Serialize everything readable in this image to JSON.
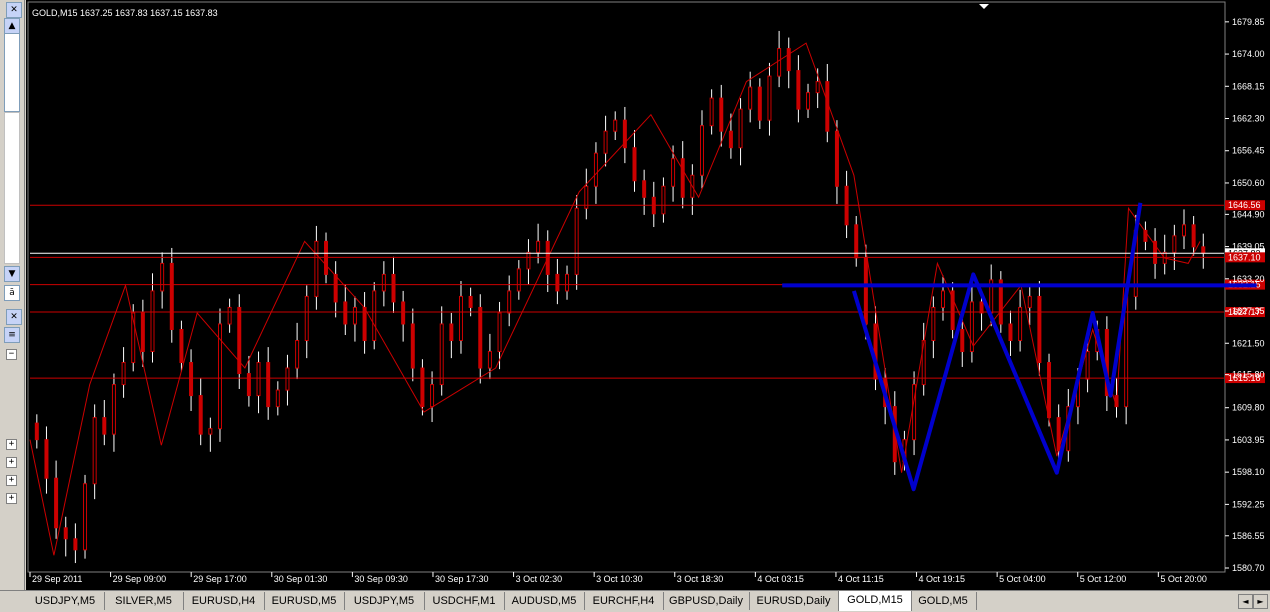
{
  "chart_header": "GOLD,M15  1637.25 1637.83 1637.15 1637.83",
  "chart_data": {
    "type": "candlestick",
    "symbol": "GOLD",
    "timeframe": "M15",
    "ohlc_last": {
      "open": 1637.25,
      "high": 1637.83,
      "low": 1637.15,
      "close": 1637.83
    },
    "ylim": [
      1580.7,
      1682.0
    ],
    "y_ticks": [
      "1679.85",
      "1674.00",
      "1668.15",
      "1662.30",
      "1656.45",
      "1650.60",
      "1644.90",
      "1639.05",
      "1633.20",
      "1627.35",
      "1621.50",
      "1615.80",
      "1609.80",
      "1603.95",
      "1598.10",
      "1592.25",
      "1586.55",
      "1580.70"
    ],
    "x_ticks": [
      "29 Sep 2011",
      "29 Sep 09:00",
      "29 Sep 17:00",
      "30 Sep 01:30",
      "30 Sep 09:30",
      "30 Sep 17:30",
      "3 Oct 02:30",
      "3 Oct 10:30",
      "3 Oct 18:30",
      "4 Oct 03:15",
      "4 Oct 11:15",
      "4 Oct 19:15",
      "5 Oct 04:00",
      "5 Oct 12:00",
      "5 Oct 20:00"
    ],
    "price_lines": [
      {
        "label": "1646.56",
        "value": 1646.56,
        "color": "#cc0000"
      },
      {
        "label": "1637.83",
        "value": 1637.83,
        "color": "#ffffff",
        "current": true
      },
      {
        "label": "1637.10",
        "value": 1637.1,
        "color": "#cc0000"
      },
      {
        "label": "1632.15",
        "value": 1632.15,
        "color": "#cc0000"
      },
      {
        "label": "1627.17",
        "value": 1627.17,
        "color": "#cc0000"
      },
      {
        "label": "1615.18",
        "value": 1615.18,
        "color": "#cc0000"
      }
    ],
    "zigzag_path": [
      [
        0,
        1604
      ],
      [
        0.02,
        1583
      ],
      [
        0.05,
        1614
      ],
      [
        0.08,
        1632
      ],
      [
        0.11,
        1603
      ],
      [
        0.14,
        1627
      ],
      [
        0.18,
        1617
      ],
      [
        0.23,
        1640
      ],
      [
        0.28,
        1628
      ],
      [
        0.33,
        1609
      ],
      [
        0.39,
        1617
      ],
      [
        0.46,
        1649
      ],
      [
        0.52,
        1663
      ],
      [
        0.56,
        1648
      ],
      [
        0.6,
        1669
      ],
      [
        0.65,
        1676
      ],
      [
        0.69,
        1652
      ],
      [
        0.73,
        1598
      ],
      [
        0.76,
        1636
      ],
      [
        0.79,
        1621
      ],
      [
        0.83,
        1632
      ],
      [
        0.86,
        1601
      ],
      [
        0.89,
        1624
      ],
      [
        0.91,
        1610
      ],
      [
        0.92,
        1646
      ],
      [
        0.95,
        1637
      ],
      [
        0.97,
        1636
      ],
      [
        0.98,
        1640
      ]
    ],
    "candles_close": [
      1604,
      1597,
      1588,
      1586,
      1584,
      1596,
      1608,
      1605,
      1614,
      1618,
      1627,
      1620,
      1631,
      1636,
      1624,
      1618,
      1612,
      1605,
      1606,
      1625,
      1628,
      1616,
      1612,
      1618,
      1610,
      1613,
      1617,
      1622,
      1630,
      1640,
      1634,
      1629,
      1625,
      1628,
      1622,
      1631,
      1634,
      1629,
      1625,
      1617,
      1610,
      1614,
      1625,
      1622,
      1630,
      1628,
      1617,
      1620,
      1627,
      1631,
      1635,
      1638,
      1640,
      1634,
      1631,
      1634,
      1646,
      1650,
      1656,
      1660,
      1662,
      1657,
      1651,
      1648,
      1645,
      1650,
      1655,
      1648,
      1652,
      1661,
      1666,
      1660,
      1657,
      1664,
      1668,
      1662,
      1670,
      1675,
      1671,
      1664,
      1667,
      1669,
      1660,
      1650,
      1643,
      1637,
      1625,
      1615,
      1610,
      1600,
      1604,
      1614,
      1622,
      1628,
      1631,
      1624,
      1620,
      1629,
      1627,
      1633,
      1625,
      1622,
      1628,
      1630,
      1618,
      1608,
      1602,
      1610,
      1615,
      1620,
      1624,
      1612,
      1610,
      1630,
      1642,
      1640,
      1636,
      1638,
      1641,
      1643,
      1639,
      1637.83
    ],
    "w_pattern": [
      [
        0.69,
        1631
      ],
      [
        0.74,
        1595
      ],
      [
        0.79,
        1634
      ],
      [
        0.86,
        1598
      ],
      [
        0.89,
        1627
      ],
      [
        0.905,
        1612
      ],
      [
        0.93,
        1647
      ]
    ],
    "neckline": {
      "y": 1632,
      "x_from": 0.63,
      "x_to": 1.0
    },
    "colors": {
      "background": "#000000",
      "candle": "#cc0000",
      "wick": "#ffffff",
      "pattern": "#0000cc",
      "axis_text": "#ffffff"
    }
  },
  "tabs": [
    {
      "label": "USDJPY,M5"
    },
    {
      "label": "SILVER,M5"
    },
    {
      "label": "EURUSD,H4"
    },
    {
      "label": "EURUSD,M5"
    },
    {
      "label": "USDJPY,M5"
    },
    {
      "label": "USDCHF,M1"
    },
    {
      "label": "AUDUSD,M5"
    },
    {
      "label": "EURCHF,H4"
    },
    {
      "label": "GBPUSD,Daily"
    },
    {
      "label": "EURUSD,Daily"
    },
    {
      "label": "GOLD,M15",
      "active": true
    },
    {
      "label": "GOLD,M5"
    }
  ],
  "icons": {
    "close": "close-icon",
    "scroll_up": "arrow-up-icon",
    "scroll_down": "arrow-down-icon",
    "tree_expand": "plus-icon",
    "tree_collapse": "minus-icon",
    "tab_prev": "arrow-left-icon",
    "tab_next": "arrow-right-icon"
  }
}
